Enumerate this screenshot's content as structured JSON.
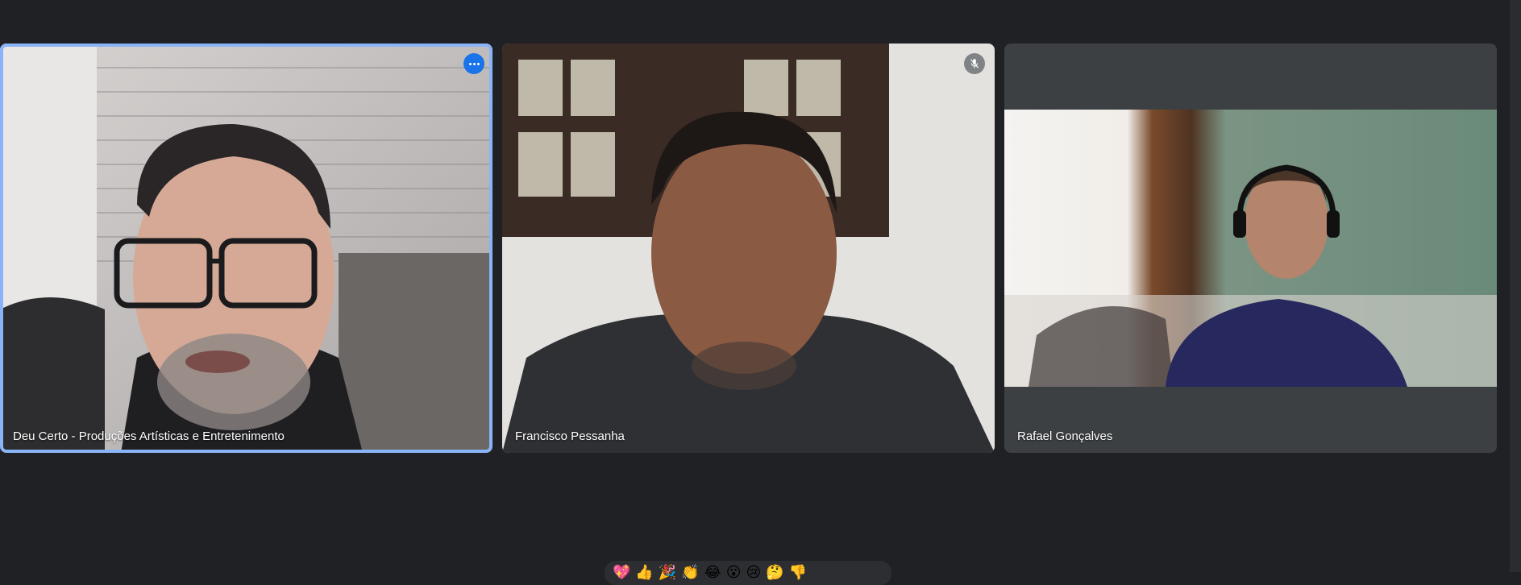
{
  "participants": [
    {
      "name": "Deu Certo - Produções Artísticas e Entretenimento",
      "active_speaker": true,
      "more_options_icon": "more-horiz-icon"
    },
    {
      "name": "Francisco Pessanha",
      "muted": true,
      "mic_icon": "mic-off-icon"
    },
    {
      "name": "Rafael Gonçalves"
    }
  ],
  "reactions": [
    "💖",
    "👍",
    "🎉",
    "👏",
    "😂",
    "😮",
    "😢",
    "🤔",
    "👎"
  ],
  "colors": {
    "background": "#202124",
    "tile": "#3c4043",
    "active_border": "#8ab4f8",
    "accent": "#1a73e8"
  }
}
